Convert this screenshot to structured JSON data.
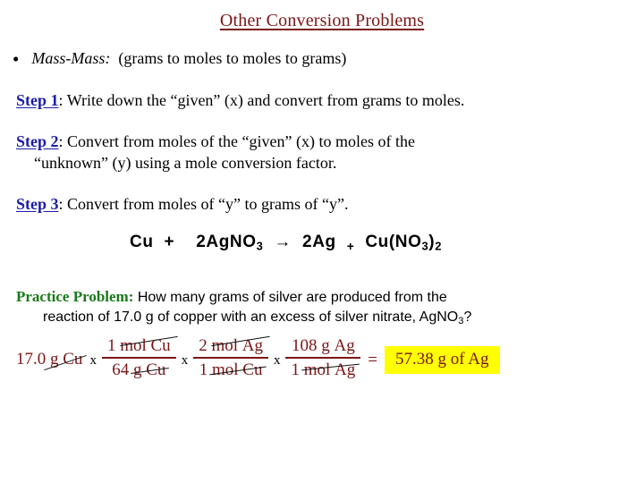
{
  "slide": {
    "title": "Other Conversion Problems"
  },
  "bullet": {
    "marker": "bullet-dot",
    "emphasis": "Mass-Mass:",
    "text": "(grams to moles to moles to grams)"
  },
  "steps": [
    {
      "label": "Step 1",
      "separator": ":",
      "line1": " Write down the “given” (x) and convert from grams to moles.",
      "line2": ""
    },
    {
      "label": "Step 2",
      "separator": ":",
      "line1": " Convert from moles of the “given” (x) to moles of the",
      "line2": "“unknown” (y) using a mole conversion factor."
    },
    {
      "label": "Step 3",
      "separator": ":",
      "line1": "  Convert from moles of “y” to grams of “y”.",
      "line2": ""
    }
  ],
  "equation": {
    "reactant1": "Cu",
    "plus1": "+",
    "reactant2_coeff": "2",
    "reactant2_formula": "AgNO",
    "reactant2_sub": "3",
    "arrow": "→",
    "product1_coeff": "2",
    "product1_formula": "Ag",
    "plus2": "+",
    "product2_a": "Cu(NO",
    "product2_sub1": "3",
    "product2_b": ")",
    "product2_sub2": "2",
    "full_text": "Cu + 2AgNO3 → 2Ag + Cu(NO3)2"
  },
  "practice": {
    "label": "Practice Problem",
    "separator": ":",
    "line1": "  How many grams of silver are produced from the",
    "line2_a": "reaction of 17.0 g of copper with an excess of silver nitrate, AgNO",
    "line2_sub": "3",
    "line2_b": "?"
  },
  "calculation": {
    "given_value": "17.0",
    "given_unit_g": "g",
    "given_unit_species": "Cu",
    "multiply_symbol": "x",
    "fractions": [
      {
        "numerator_coeff": "1",
        "numerator_unit": "mol",
        "numerator_species": "Cu",
        "denominator_coeff": "64",
        "denominator_unit": "g",
        "denominator_species": "Cu"
      },
      {
        "numerator_coeff": "2",
        "numerator_unit": "mol",
        "numerator_species": "Ag",
        "denominator_coeff": "1",
        "denominator_unit": "mol",
        "denominator_species": "Cu"
      },
      {
        "numerator_coeff": "108",
        "numerator_unit": "g",
        "numerator_species": "Ag",
        "denominator_coeff": "1",
        "denominator_unit": "mol",
        "denominator_species": "Ag"
      }
    ],
    "equals_symbol": "=",
    "answer": "57.38 g of Ag"
  },
  "colors": {
    "title_maroon": "#7B1516",
    "step_blue": "#1D1DA8",
    "practice_green": "#1A7A1A",
    "calc_maroon": "#7B1516",
    "highlight_yellow": "#FFFF00",
    "body_black": "#000000",
    "background": "#FFFFFF"
  }
}
